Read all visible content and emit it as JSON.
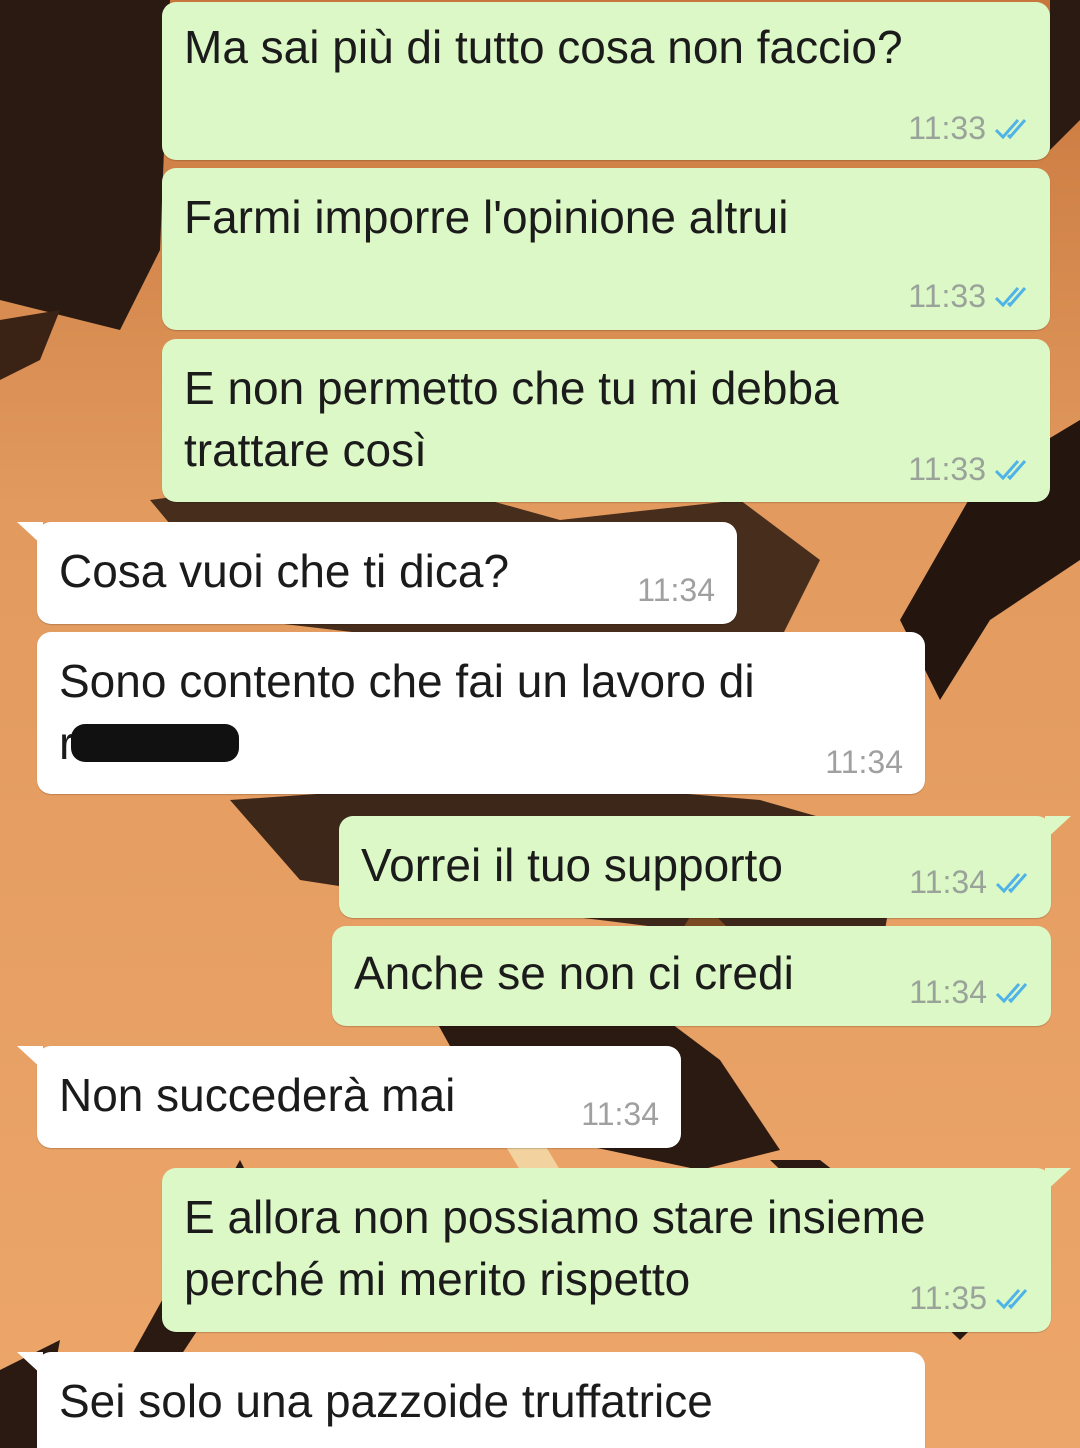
{
  "colors": {
    "outgoing_bubble": "#dcf8c6",
    "incoming_bubble": "#ffffff",
    "read_ticks": "#4fb3e8",
    "wallpaper_sky": "#e0975e"
  },
  "icons": [
    "double-check-icon"
  ],
  "messages": [
    {
      "id": 1,
      "direction": "outgoing",
      "text": "Ma sai più di tutto cosa non faccio?",
      "time": "11:33",
      "status": "read"
    },
    {
      "id": 2,
      "direction": "outgoing",
      "text": "Farmi imporre l'opinione altrui",
      "time": "11:33",
      "status": "read"
    },
    {
      "id": 3,
      "direction": "outgoing",
      "text": "E non permetto che tu mi debba\ntrattare così",
      "time": "11:33",
      "status": "read"
    },
    {
      "id": 4,
      "direction": "incoming",
      "text": "Cosa vuoi che ti dica?",
      "time": "11:34"
    },
    {
      "id": 5,
      "direction": "incoming",
      "text": "Sono contento che fai un lavoro di\nr          ?",
      "time": "11:34",
      "redacted": true
    },
    {
      "id": 6,
      "direction": "outgoing",
      "text": "Vorrei il tuo supporto",
      "time": "11:34",
      "status": "read"
    },
    {
      "id": 7,
      "direction": "outgoing",
      "text": "Anche se non ci credi",
      "time": "11:34",
      "status": "read"
    },
    {
      "id": 8,
      "direction": "incoming",
      "text": "Non succederà mai",
      "time": "11:34"
    },
    {
      "id": 9,
      "direction": "outgoing",
      "text": "E allora non possiamo stare insieme\nperché mi merito rispetto",
      "time": "11:35",
      "status": "read"
    },
    {
      "id": 10,
      "direction": "incoming",
      "text": "Sei solo una pazzoide truffatrice",
      "time": ""
    }
  ]
}
